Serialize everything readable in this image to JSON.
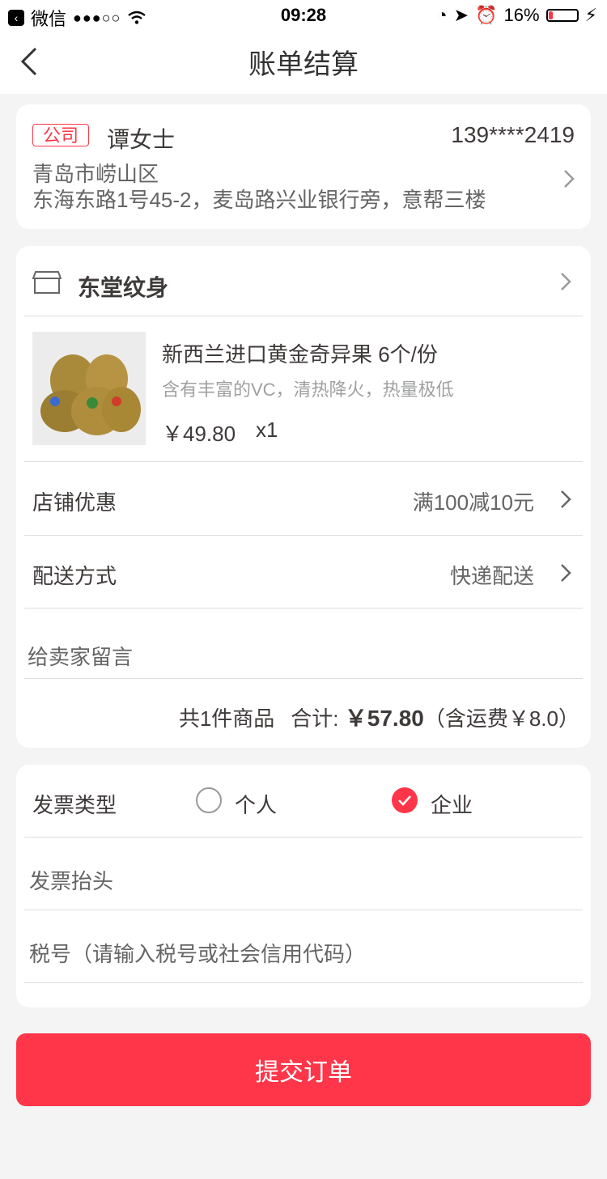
{
  "status_bar": {
    "carrier": "微信",
    "signal": "●●●○○",
    "time": "09:28",
    "battery_text": "16%",
    "battery_level": 0.16
  },
  "nav": {
    "title": "账单结算",
    "back_icon": "chevron-left-icon"
  },
  "address": {
    "tag": "公司",
    "name": "谭女士",
    "phone": "139****2419",
    "line1": "青岛市崂山区",
    "line2": "东海东路1号45-2，麦岛路兴业银行旁，意帮三楼"
  },
  "shop": {
    "name": "东堂纹身"
  },
  "product": {
    "title": "新西兰进口黄金奇异果 6个/份",
    "desc": "含有丰富的VC，清热降火，热量极低",
    "price": "￥49.80",
    "qty": "x1"
  },
  "discount": {
    "label": "店铺优惠",
    "value": "满100减10元"
  },
  "delivery": {
    "label": "配送方式",
    "value": "快递配送"
  },
  "message": {
    "placeholder": "给卖家留言"
  },
  "summary": {
    "count_text": "共1件商品",
    "total_label": "合计:",
    "amount": "￥57.80",
    "shipping": "（含运费￥8.0）"
  },
  "invoice": {
    "type_label": "发票类型",
    "option_personal": "个人",
    "option_company": "企业",
    "selected": "企业",
    "title_placeholder": "发票抬头",
    "tax_placeholder": "税号（请输入税号或社会信用代码）"
  },
  "submit": {
    "label": "提交订单"
  },
  "colors": {
    "accent": "#ff3649",
    "text_primary": "#3e3a39",
    "text_secondary": "#666464",
    "text_muted": "#9fa0a0",
    "divider": "#dddddd"
  }
}
